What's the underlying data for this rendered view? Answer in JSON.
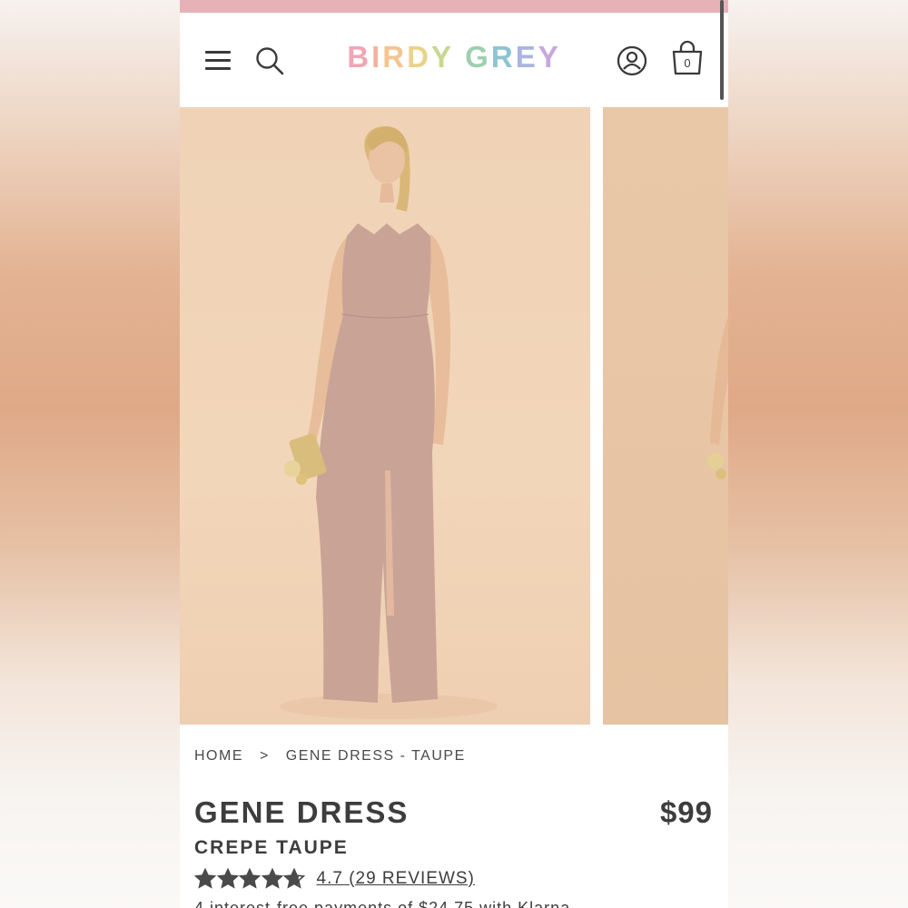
{
  "colors": {
    "top_strip": "#e6b2b8",
    "text_dark": "#3d3d3d",
    "star": "#4a4a4a"
  },
  "header": {
    "menu_icon": "hamburger-menu-icon",
    "search_icon": "search-icon",
    "logo_letters": [
      {
        "char": "B",
        "color": "#f0a6b4"
      },
      {
        "char": "I",
        "color": "#f3b39c"
      },
      {
        "char": "R",
        "color": "#f5c48f"
      },
      {
        "char": "D",
        "color": "#e9d38a"
      },
      {
        "char": "Y",
        "color": "#c9d68f"
      },
      {
        "char": " ",
        "color": "#ffffff"
      },
      {
        "char": "G",
        "color": "#9fcfb0"
      },
      {
        "char": "R",
        "color": "#8fc3d2"
      },
      {
        "char": "E",
        "color": "#a9b5e0"
      },
      {
        "char": "Y",
        "color": "#c8a8dc"
      }
    ],
    "account_icon": "account-icon",
    "bag_icon": "shopping-bag-icon",
    "bag_count": "0"
  },
  "gallery": {
    "slides": [
      "product-photo-front",
      "product-photo-side"
    ]
  },
  "breadcrumb": {
    "home": "HOME",
    "separator": ">",
    "current": "GENE DRESS - TAUPE"
  },
  "product": {
    "title": "GENE DRESS",
    "price": "$99",
    "color": "CREPE TAUPE",
    "rating_value": 4.7,
    "rating_max": 5,
    "reviews_label": "4.7 (29 REVIEWS)",
    "installments_text": "4 interest-free payments of $24.75 with Klarna"
  }
}
